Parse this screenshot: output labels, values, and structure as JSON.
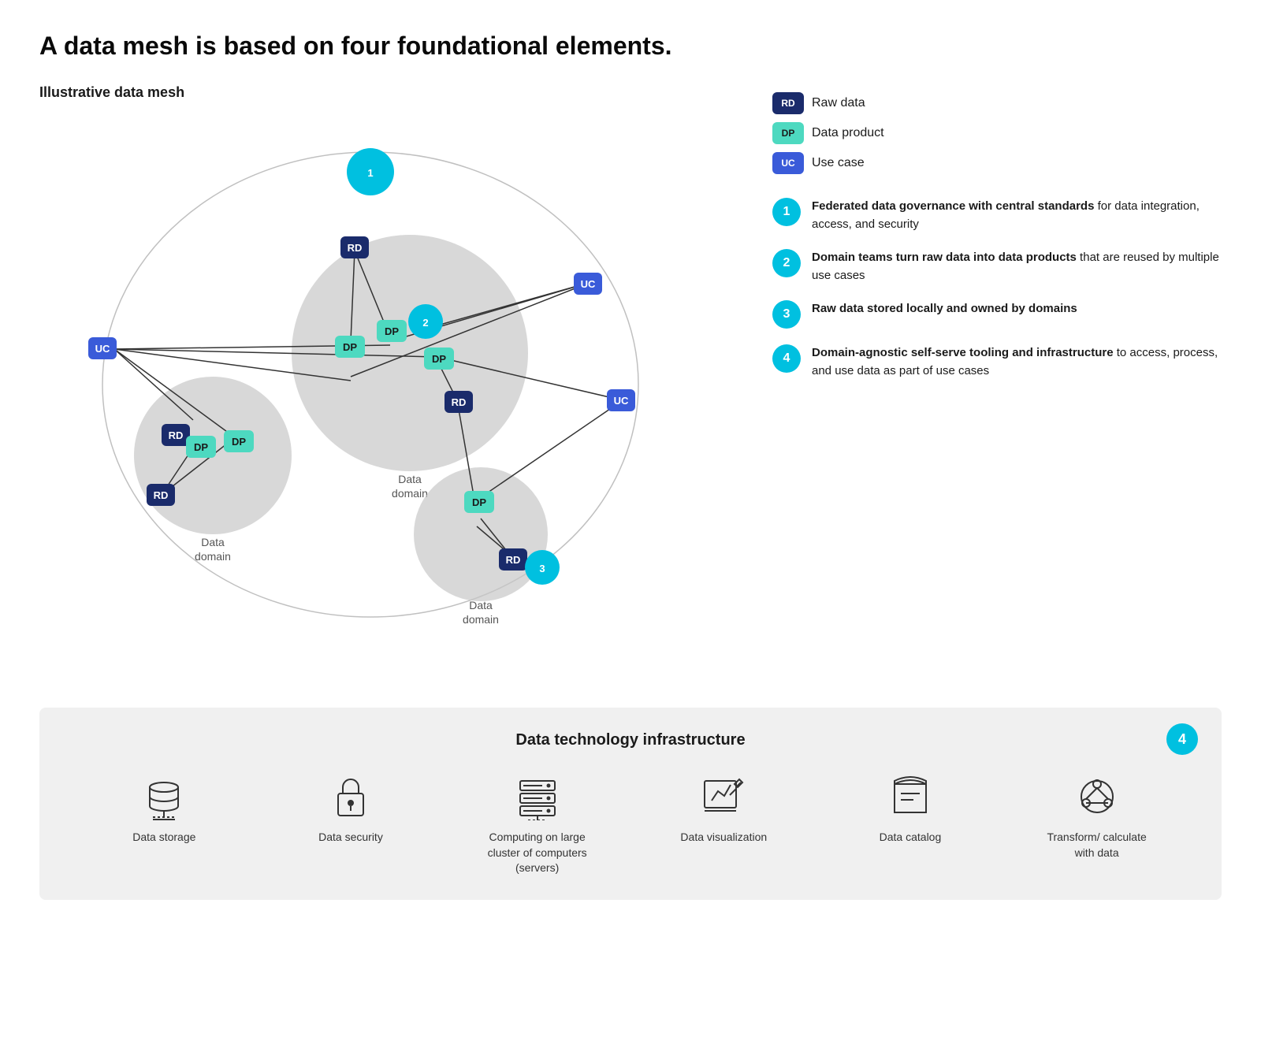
{
  "title": "A data mesh is based on four foundational elements.",
  "diagram_label": "Illustrative data mesh",
  "legend": [
    {
      "id": "rd",
      "label": "Raw data",
      "type": "rd"
    },
    {
      "id": "dp",
      "label": "Data product",
      "type": "dp"
    },
    {
      "id": "uc",
      "label": "Use case",
      "type": "uc"
    }
  ],
  "key_items": [
    {
      "number": "1",
      "text_bold": "Federated data governance with central standards",
      "text_normal": " for data integration, access, and security"
    },
    {
      "number": "2",
      "text_bold": "Domain teams turn raw data into data products",
      "text_normal": " that are reused by multiple use cases"
    },
    {
      "number": "3",
      "text_bold": "Raw data stored locally and owned by domains",
      "text_normal": ""
    },
    {
      "number": "4",
      "text_bold": "Domain-agnostic self-serve tooling and infrastructure",
      "text_normal": " to access, process, and use data as part of use cases"
    }
  ],
  "infra": {
    "title": "Data technology infrastructure",
    "number": "4",
    "items": [
      {
        "id": "data-storage",
        "label": "Data storage"
      },
      {
        "id": "data-security",
        "label": "Data security"
      },
      {
        "id": "computing",
        "label": "Computing on large cluster of computers (servers)"
      },
      {
        "id": "data-viz",
        "label": "Data visualization"
      },
      {
        "id": "data-catalog",
        "label": "Data catalog"
      },
      {
        "id": "transform",
        "label": "Transform/ calculate with data"
      }
    ]
  }
}
